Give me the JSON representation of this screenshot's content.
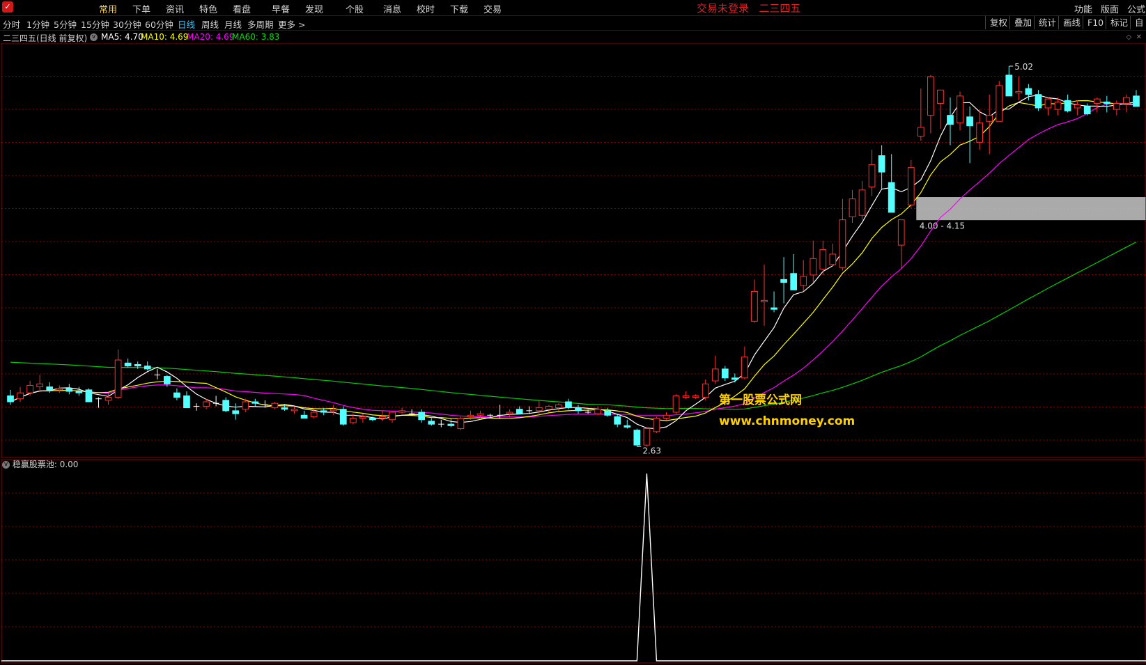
{
  "menu": {
    "items": [
      "常用",
      "下单",
      "资讯",
      "特色",
      "看盘",
      "早餐",
      "发现",
      "个股",
      "消息",
      "校时",
      "下载",
      "交易"
    ],
    "active_index": 0,
    "status": "交易未登录",
    "stock_name": "二三四五",
    "right_items": [
      "功能",
      "版面",
      "公式"
    ]
  },
  "tabs": {
    "periods": [
      "分时",
      "1分钟",
      "5分钟",
      "15分钟",
      "30分钟",
      "60分钟",
      "日线",
      "周线",
      "月线",
      "多周期",
      "更多 >"
    ],
    "active_period": "日线",
    "tools": [
      "复权",
      "叠加",
      "统计",
      "画线",
      "F10",
      "标记",
      "自"
    ]
  },
  "legend": {
    "title": "二三四五(日线 前复权)",
    "ma5": "MA5: 4.70",
    "ma10": "MA10: 4.69",
    "ma20": "MA20: 4.69",
    "ma60": "MA60: 3.83"
  },
  "colors": {
    "up": "#ff3030",
    "down": "#54ffff",
    "ma5": "#ffffff",
    "ma10": "#ffff00",
    "ma20": "#ff00ff",
    "ma60": "#00d000",
    "grid": "#8a0000",
    "zone": "#c8c8c8"
  },
  "annotations": {
    "high": "5.02",
    "low": "2.63",
    "zone": "4.00 - 4.15"
  },
  "sub_indicator": {
    "label": "稳赢股票池",
    "value": ": 0.00"
  },
  "watermark": {
    "line1": "第一股票公式网",
    "line2": "www.chnmoney.com"
  },
  "chart_data": {
    "type": "candlestick",
    "ylim": [
      2.5,
      5.1
    ],
    "zone": [
      4.0,
      4.15
    ],
    "candles": [
      [
        2.82,
        2.86,
        2.76,
        2.78
      ],
      [
        2.8,
        2.88,
        2.78,
        2.84
      ],
      [
        2.84,
        2.92,
        2.82,
        2.89
      ],
      [
        2.88,
        2.96,
        2.85,
        2.9
      ],
      [
        2.88,
        2.91,
        2.84,
        2.86
      ],
      [
        2.86,
        2.89,
        2.84,
        2.87
      ],
      [
        2.87,
        2.9,
        2.83,
        2.85
      ],
      [
        2.85,
        2.88,
        2.82,
        2.84
      ],
      [
        2.86,
        2.87,
        2.78,
        2.78
      ],
      [
        2.8,
        2.81,
        2.74,
        2.8
      ],
      [
        2.79,
        2.84,
        2.76,
        2.81
      ],
      [
        2.81,
        3.13,
        2.8,
        3.06
      ],
      [
        3.04,
        3.07,
        3.01,
        3.02
      ],
      [
        3.03,
        3.05,
        3.0,
        3.02
      ],
      [
        3.02,
        3.05,
        2.99,
        3.0
      ],
      [
        2.96,
        3.0,
        2.93,
        2.96
      ],
      [
        2.95,
        2.96,
        2.88,
        2.9
      ],
      [
        2.84,
        2.87,
        2.79,
        2.81
      ],
      [
        2.82,
        2.85,
        2.74,
        2.74
      ],
      [
        2.75,
        2.77,
        2.72,
        2.75
      ],
      [
        2.75,
        2.8,
        2.73,
        2.78
      ],
      [
        2.77,
        2.82,
        2.75,
        2.77
      ],
      [
        2.79,
        2.81,
        2.71,
        2.72
      ],
      [
        2.72,
        2.77,
        2.66,
        2.7
      ],
      [
        2.73,
        2.8,
        2.71,
        2.78
      ],
      [
        2.78,
        2.8,
        2.75,
        2.77
      ],
      [
        2.76,
        2.79,
        2.74,
        2.76
      ],
      [
        2.74,
        2.78,
        2.73,
        2.77
      ],
      [
        2.74,
        2.76,
        2.72,
        2.73
      ],
      [
        2.72,
        2.75,
        2.7,
        2.73
      ],
      [
        2.69,
        2.72,
        2.67,
        2.67
      ],
      [
        2.68,
        2.73,
        2.67,
        2.71
      ],
      [
        2.72,
        2.74,
        2.69,
        2.71
      ],
      [
        2.72,
        2.76,
        2.69,
        2.73
      ],
      [
        2.73,
        2.75,
        2.62,
        2.63
      ],
      [
        2.64,
        2.7,
        2.63,
        2.67
      ],
      [
        2.67,
        2.7,
        2.64,
        2.68
      ],
      [
        2.67,
        2.68,
        2.65,
        2.66
      ],
      [
        2.67,
        2.72,
        2.65,
        2.68
      ],
      [
        2.66,
        2.72,
        2.64,
        2.71
      ],
      [
        2.71,
        2.74,
        2.7,
        2.72
      ],
      [
        2.7,
        2.73,
        2.69,
        2.7
      ],
      [
        2.71,
        2.73,
        2.64,
        2.66
      ],
      [
        2.65,
        2.67,
        2.62,
        2.63
      ],
      [
        2.63,
        2.66,
        2.61,
        2.63
      ],
      [
        2.63,
        2.67,
        2.61,
        2.62
      ],
      [
        2.6,
        2.68,
        2.59,
        2.67
      ],
      [
        2.68,
        2.72,
        2.66,
        2.69
      ],
      [
        2.69,
        2.72,
        2.67,
        2.7
      ],
      [
        2.69,
        2.7,
        2.67,
        2.69
      ],
      [
        2.69,
        2.76,
        2.67,
        2.69
      ],
      [
        2.7,
        2.73,
        2.68,
        2.71
      ],
      [
        2.73,
        2.75,
        2.7,
        2.7
      ],
      [
        2.72,
        2.75,
        2.7,
        2.72
      ],
      [
        2.72,
        2.79,
        2.7,
        2.74
      ],
      [
        2.73,
        2.76,
        2.71,
        2.75
      ],
      [
        2.74,
        2.77,
        2.72,
        2.76
      ],
      [
        2.78,
        2.8,
        2.73,
        2.74
      ],
      [
        2.74,
        2.76,
        2.7,
        2.72
      ],
      [
        2.71,
        2.73,
        2.7,
        2.71
      ],
      [
        2.7,
        2.75,
        2.69,
        2.73
      ],
      [
        2.72,
        2.74,
        2.68,
        2.69
      ],
      [
        2.68,
        2.7,
        2.61,
        2.63
      ],
      [
        2.62,
        2.66,
        2.6,
        2.61
      ],
      [
        2.59,
        2.6,
        2.48,
        2.49
      ],
      [
        2.49,
        2.61,
        2.48,
        2.6
      ],
      [
        2.58,
        2.68,
        2.57,
        2.67
      ],
      [
        2.67,
        2.71,
        2.66,
        2.69
      ],
      [
        2.71,
        2.83,
        2.7,
        2.82
      ],
      [
        2.81,
        2.85,
        2.8,
        2.82
      ],
      [
        2.81,
        2.83,
        2.8,
        2.82
      ],
      [
        2.81,
        2.93,
        2.79,
        2.9
      ],
      [
        2.92,
        3.09,
        2.9,
        3.0
      ],
      [
        3.0,
        3.02,
        2.92,
        2.94
      ],
      [
        2.94,
        2.97,
        2.91,
        2.93
      ],
      [
        2.94,
        3.15,
        2.93,
        3.08
      ],
      [
        3.32,
        3.6,
        3.31,
        3.52
      ],
      [
        3.45,
        3.7,
        3.29,
        3.46
      ],
      [
        3.41,
        3.52,
        3.38,
        3.4
      ],
      [
        3.6,
        3.75,
        3.44,
        3.58
      ],
      [
        3.64,
        3.77,
        3.55,
        3.53
      ],
      [
        3.56,
        3.73,
        3.52,
        3.62
      ],
      [
        3.63,
        3.86,
        3.58,
        3.74
      ],
      [
        3.67,
        3.86,
        3.63,
        3.8
      ],
      [
        3.7,
        3.84,
        3.69,
        3.77
      ],
      [
        3.68,
        4.14,
        3.66,
        4.0
      ],
      [
        4.02,
        4.2,
        3.98,
        4.14
      ],
      [
        4.03,
        4.26,
        4.0,
        4.2
      ],
      [
        4.22,
        4.47,
        4.16,
        4.37
      ],
      [
        4.43,
        4.5,
        4.2,
        4.32
      ],
      [
        4.25,
        4.44,
        4.16,
        4.05
      ],
      [
        3.83,
        4.0,
        3.67,
        4.0
      ],
      [
        4.1,
        4.4,
        4.08,
        4.35
      ],
      [
        4.56,
        4.88,
        4.53,
        4.62
      ],
      [
        4.7,
        4.97,
        4.58,
        4.96
      ],
      [
        4.78,
        4.86,
        4.61,
        4.87
      ],
      [
        4.7,
        4.82,
        4.5,
        4.64
      ],
      [
        4.65,
        4.86,
        4.6,
        4.83
      ],
      [
        4.69,
        4.76,
        4.38,
        4.63
      ],
      [
        4.52,
        4.74,
        4.47,
        4.65
      ],
      [
        4.66,
        4.84,
        4.44,
        4.7
      ],
      [
        4.66,
        4.93,
        4.7,
        4.9
      ],
      [
        4.97,
        5.03,
        4.83,
        4.83
      ],
      [
        4.85,
        4.96,
        4.8,
        4.86
      ],
      [
        4.88,
        4.91,
        4.8,
        4.84
      ],
      [
        4.84,
        4.87,
        4.73,
        4.75
      ],
      [
        4.75,
        4.82,
        4.7,
        4.81
      ],
      [
        4.74,
        4.82,
        4.7,
        4.79
      ],
      [
        4.8,
        4.84,
        4.72,
        4.73
      ],
      [
        4.75,
        4.8,
        4.7,
        4.77
      ],
      [
        4.76,
        4.78,
        4.7,
        4.71
      ],
      [
        4.78,
        4.82,
        4.72,
        4.81
      ],
      [
        4.79,
        4.83,
        4.72,
        4.78
      ],
      [
        4.74,
        4.8,
        4.7,
        4.78
      ],
      [
        4.78,
        4.84,
        4.72,
        4.82
      ],
      [
        4.83,
        4.87,
        4.76,
        4.76
      ]
    ],
    "indicator": {
      "peak_index": 65,
      "ylim": [
        0,
        1
      ]
    }
  }
}
